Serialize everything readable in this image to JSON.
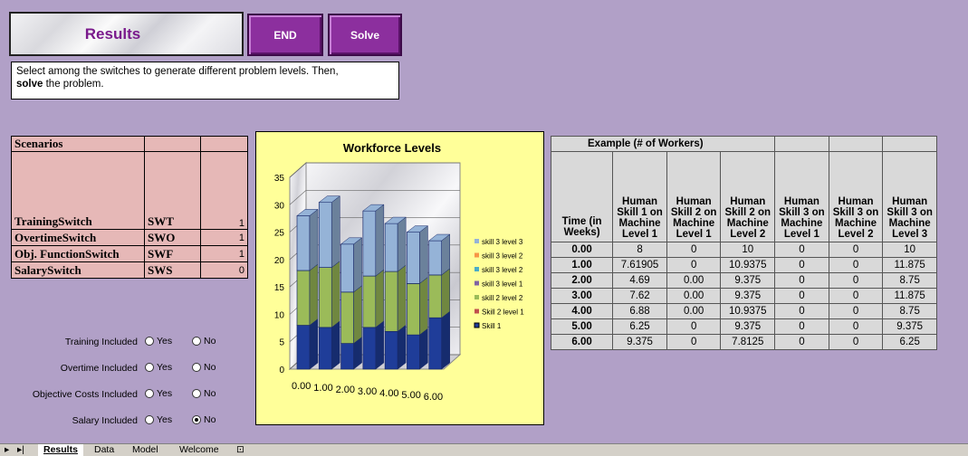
{
  "header": {
    "title": "Results",
    "end_label": "END",
    "solve_label": "Solve"
  },
  "instructions": {
    "line1": "Select among the switches to generate different problem levels. Then,",
    "bold": "solve",
    "rest": " the problem."
  },
  "scenarios": {
    "heading": "Scenarios",
    "rows": [
      {
        "name": "TrainingSwitch",
        "code": "SWT",
        "value": "1"
      },
      {
        "name": "OvertimeSwitch",
        "code": "SWO",
        "value": "1"
      },
      {
        "name": "Obj. FunctionSwitch",
        "code": "SWF",
        "value": "1"
      },
      {
        "name": "SalarySwitch",
        "code": "SWS",
        "value": "0"
      }
    ]
  },
  "options": [
    {
      "label": "Training Included",
      "yes": "Yes",
      "no": "No",
      "selected": "none"
    },
    {
      "label": "Overtime Included",
      "yes": "Yes",
      "no": "No",
      "selected": "none"
    },
    {
      "label": "Objective Costs Included",
      "yes": "Yes",
      "no": "No",
      "selected": "none"
    },
    {
      "label": "Salary Included",
      "yes": "Yes",
      "no": "No",
      "selected": "no"
    }
  ],
  "chart_data": {
    "type": "bar",
    "stacked": true,
    "title": "Workforce Levels",
    "categories": [
      "0.00",
      "1.00",
      "2.00",
      "3.00",
      "4.00",
      "5.00",
      "6.00"
    ],
    "ylim": [
      0,
      35
    ],
    "yticks": [
      "0",
      "5",
      "10",
      "15",
      "20",
      "25",
      "30",
      "35"
    ],
    "legend_position": "right",
    "series": [
      {
        "name": "Skill 1",
        "color": "#1f3d99",
        "values": [
          8,
          7.61905,
          4.69,
          7.62,
          6.88,
          6.25,
          9.375
        ]
      },
      {
        "name": "Skill 2 level 1",
        "color": "#c0504d",
        "values": [
          0,
          0,
          0,
          0,
          0,
          0,
          0
        ]
      },
      {
        "name": "skill 2 level 2",
        "color": "#9bbb59",
        "values": [
          10,
          10.9375,
          9.375,
          9.375,
          10.9375,
          9.375,
          7.8125
        ]
      },
      {
        "name": "skill 3 level 1",
        "color": "#8064a2",
        "values": [
          0,
          0,
          0,
          0,
          0,
          0,
          0
        ]
      },
      {
        "name": "skill 3 level 2",
        "color": "#4bacc6",
        "values": [
          0,
          0,
          0,
          0,
          0,
          0,
          0
        ]
      },
      {
        "name": "skill 3 level 2",
        "color": "#f79646",
        "values": [
          0,
          0,
          0,
          0,
          0,
          0,
          0
        ]
      },
      {
        "name": "skill 3 level 3",
        "color": "#95b3d7",
        "values": [
          10,
          11.875,
          8.75,
          11.875,
          8.75,
          9.375,
          6.25
        ]
      }
    ]
  },
  "example": {
    "heading": "Example (# of Workers)",
    "columns": [
      "Time (in Weeks)",
      "Human Skill 1 on Machine Level 1",
      "Human Skill 2 on Machine Level 1",
      "Human Skill 2 on Machine Level 2",
      "Human Skill 3 on Machine Level 1",
      "Human Skill 3 on Machine Level 2",
      "Human Skill 3 on Machine Level 3"
    ],
    "rows": [
      [
        "0.00",
        "8",
        "0",
        "10",
        "0",
        "0",
        "10"
      ],
      [
        "1.00",
        "7.61905",
        "0",
        "10.9375",
        "0",
        "0",
        "11.875"
      ],
      [
        "2.00",
        "4.69",
        "0.00",
        "9.375",
        "0",
        "0",
        "8.75"
      ],
      [
        "3.00",
        "7.62",
        "0.00",
        "9.375",
        "0",
        "0",
        "11.875"
      ],
      [
        "4.00",
        "6.88",
        "0.00",
        "10.9375",
        "0",
        "0",
        "8.75"
      ],
      [
        "5.00",
        "6.25",
        "0",
        "9.375",
        "0",
        "0",
        "9.375"
      ],
      [
        "6.00",
        "9.375",
        "0",
        "7.8125",
        "0",
        "0",
        "6.25"
      ]
    ]
  },
  "sheet_tabs": [
    "Results",
    "Data",
    "Model",
    "Welcome"
  ],
  "colors": {
    "background": "#b1a0c7",
    "accent": "#8c2f9e",
    "scenario_fill": "#e6b8b7",
    "chart_fill": "#ffff99"
  }
}
